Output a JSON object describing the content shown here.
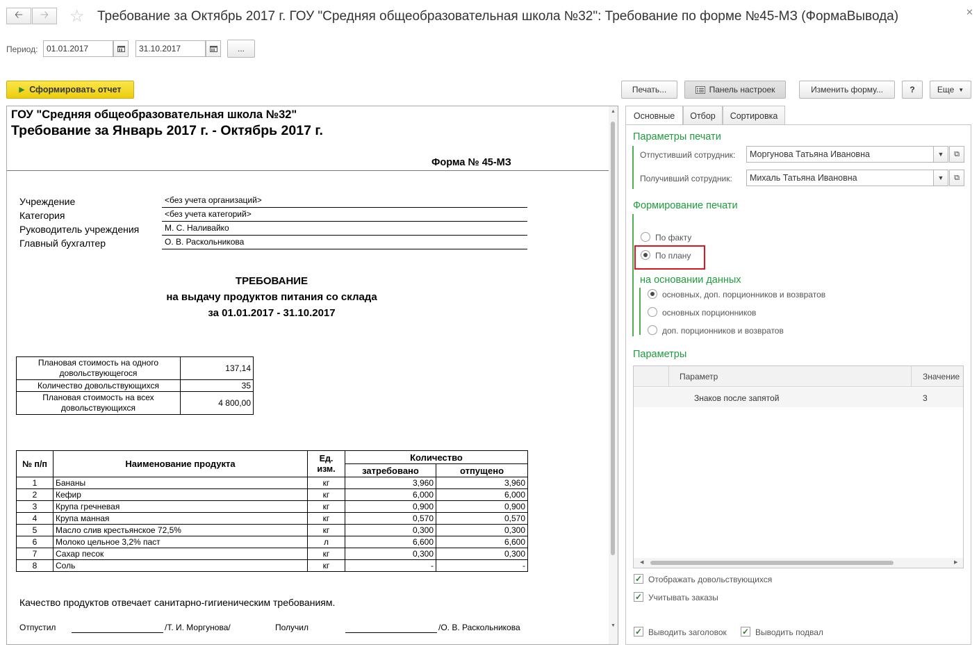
{
  "window": {
    "title": "Требование за Октябрь 2017 г. ГОУ \"Средняя общеобразовательная школа №32\": Требование по форме №45-МЗ (ФормаВывода)"
  },
  "period": {
    "label": "Период:",
    "start": "01.01.2017",
    "end": "31.10.2017",
    "more_label": "..."
  },
  "toolbar": {
    "generate_label": "Сформировать отчет",
    "print_label": "Печать...",
    "settings_panel_label": "Панель настроек",
    "change_form_label": "Изменить форму...",
    "help_label": "?",
    "more_label": "Еще"
  },
  "report": {
    "org": "ГОУ \"Средняя общеобразовательная школа №32\"",
    "title": "Требование  за Январь 2017 г. - Октябрь 2017 г.",
    "form": "Форма № 45-МЗ",
    "info": [
      {
        "label": "Учреждение",
        "value": "<без учета организаций>"
      },
      {
        "label": "Категория",
        "value": "<без учета категорий>"
      },
      {
        "label": "Руководитель учреждения",
        "value": "М. С. Наливайко"
      },
      {
        "label": "Главный бухгалтер",
        "value": "О. В. Раскольникова"
      }
    ],
    "heading1": "ТРЕБОВАНИЕ",
    "heading2": "на выдачу продуктов питания со склада",
    "heading3": "за 01.01.2017 - 31.10.2017",
    "summary": [
      {
        "label": "Плановая стоимость на одного довольствующегося",
        "value": "137,14"
      },
      {
        "label": "Количество довольствующихся",
        "value": "35"
      },
      {
        "label": "Плановая стоимость на всех довольствующихся",
        "value": "4 800,00"
      }
    ],
    "table": {
      "col_num": "№ п/п",
      "col_name": "Наименование продукта",
      "col_unit": "Ед. изм.",
      "col_qty": "Количество",
      "col_req": "затребовано",
      "col_rel": "отпущено",
      "rows": [
        {
          "n": "1",
          "name": "Бананы",
          "unit": "кг",
          "req": "3,960",
          "rel": "3,960"
        },
        {
          "n": "2",
          "name": "Кефир",
          "unit": "кг",
          "req": "6,000",
          "rel": "6,000"
        },
        {
          "n": "3",
          "name": "Крупа гречневая",
          "unit": "кг",
          "req": "0,900",
          "rel": "0,900"
        },
        {
          "n": "4",
          "name": "Крупа манная",
          "unit": "кг",
          "req": "0,570",
          "rel": "0,570"
        },
        {
          "n": "5",
          "name": "Масло слив крестьянское 72,5%",
          "unit": "кг",
          "req": "0,300",
          "rel": "0,300"
        },
        {
          "n": "6",
          "name": "Молоко цельное 3,2% паст",
          "unit": "л",
          "req": "6,600",
          "rel": "6,600"
        },
        {
          "n": "7",
          "name": "Сахар песок",
          "unit": "кг",
          "req": "0,300",
          "rel": "0,300"
        },
        {
          "n": "8",
          "name": "Соль",
          "unit": "кг",
          "req": "-",
          "rel": "-"
        }
      ]
    },
    "quality_note": "Качество продуктов отвечает санитарно-гигиеническим требованиям.",
    "released_label": "Отпустил",
    "released_name": "/Т. И. Моргунова/",
    "received_label": "Получил",
    "received_name": "/О. В. Раскольникова"
  },
  "settings": {
    "tabs": [
      "Основные",
      "Отбор",
      "Сортировка"
    ],
    "print_params_title": "Параметры печати",
    "released_employee_label": "Отпустивший сотрудник:",
    "released_employee_value": "Моргунова Татьяна Ивановна",
    "received_employee_label": "Получивший сотрудник:",
    "received_employee_value": "Михаль Татьяна Ивановна",
    "print_forming_title": "Формирование печати",
    "by_fact_label": "По факту",
    "by_plan_label": "По плану",
    "data_basis_title": "на основании данных",
    "basis_options": [
      "основных, доп. порционников и возвратов",
      "основных порционников",
      "доп. порционников и возвратов"
    ],
    "params_title": "Параметры",
    "params_table": {
      "col_param": "Параметр",
      "col_value": "Значение",
      "rows": [
        {
          "param": "Знаков после запятой",
          "value": "3"
        }
      ]
    },
    "show_consumers_label": "Отображать довольствующихся",
    "consider_orders_label": "Учитывать заказы",
    "show_header_label": "Выводить заголовок",
    "show_footer_label": "Выводить подвал"
  },
  "colors": {
    "accent_green": "#1e9c3c",
    "generate_button": "#f6d81a",
    "highlight_red": "#e0141e"
  }
}
